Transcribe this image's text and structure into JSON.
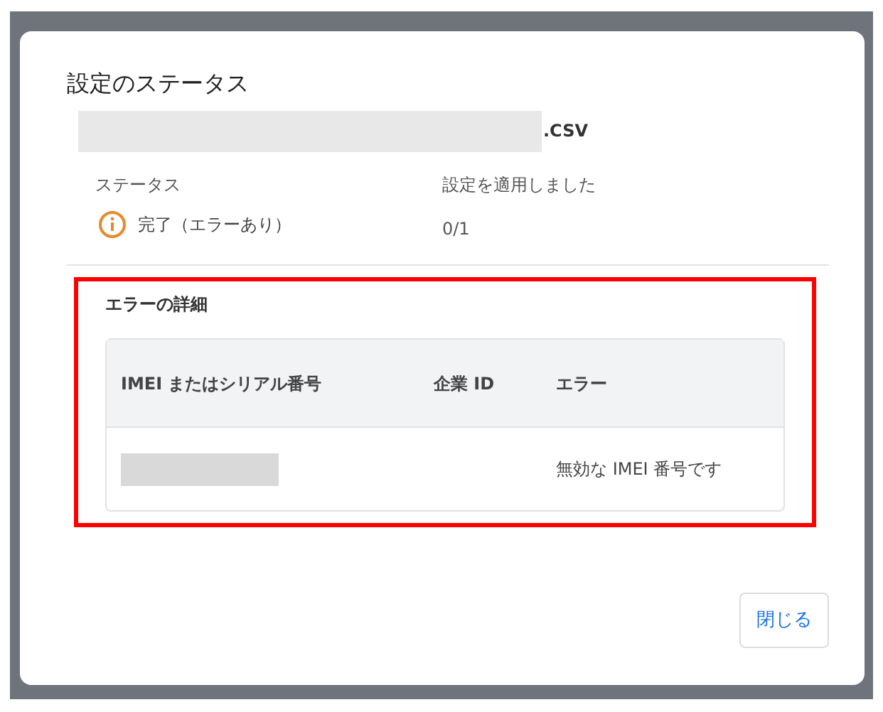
{
  "dialog": {
    "title": "設定のステータス",
    "file": {
      "redacted": true,
      "extension": ".CSV"
    },
    "status": {
      "label": "ステータス",
      "value": "完了（エラーあり）"
    },
    "applied": {
      "label": "設定を適用しました",
      "value": "0/1"
    },
    "error_details": {
      "highlighted": true,
      "title": "エラーの詳細",
      "table": {
        "columns": [
          "IMEI またはシリアル番号",
          "企業 ID",
          "エラー"
        ],
        "rows": [
          {
            "redacted": true,
            "error": "無効な IMEI 番号です"
          }
        ]
      }
    },
    "buttons": [
      "閉じる"
    ]
  }
}
